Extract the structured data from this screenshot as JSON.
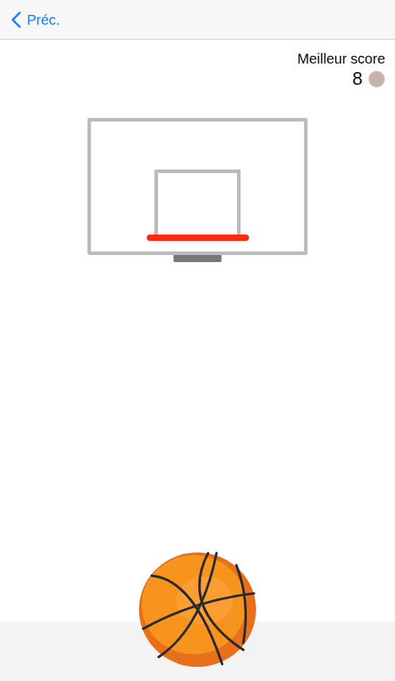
{
  "nav": {
    "back_label": "Préc."
  },
  "best_score": {
    "label": "Meilleur score",
    "value": "8"
  }
}
